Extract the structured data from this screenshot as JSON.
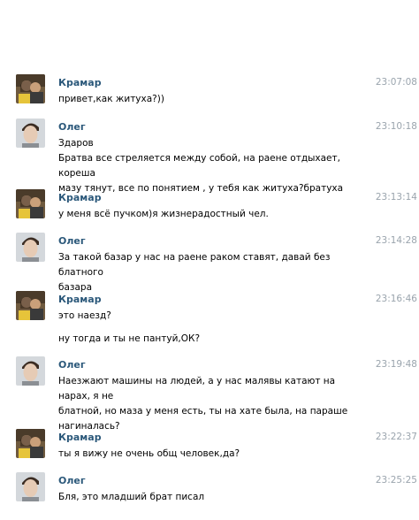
{
  "messages": [
    {
      "author": "Крамар",
      "time": "23:07:08",
      "avatar": "avatar-couple",
      "lines": [
        "привет,как житуха?))"
      ]
    },
    {
      "author": "Олег",
      "time": "23:10:18",
      "avatar": "avatar-young-man",
      "lines": [
        "Здаров",
        "Братва все стреляется между собой, на раене отдыхает, кореша",
        "мазу тянут, все по понятием , у тебя как житуха?братуха"
      ]
    },
    {
      "author": "Крамар",
      "time": "23:13:14",
      "avatar": "avatar-couple",
      "lines": [
        "у меня всё пучком)я жизнерадостный чел."
      ]
    },
    {
      "author": "Олег",
      "time": "23:14:28",
      "avatar": "avatar-young-man",
      "lines": [
        "За такой базар у нас на раене раком ставят, давай без блатного",
        "базара"
      ]
    },
    {
      "author": "Крамар",
      "time": "23:16:46",
      "avatar": "avatar-couple",
      "lines": [
        "это наезд?",
        "",
        "ну тогда и ты не пантуй,ОК?"
      ]
    },
    {
      "author": "Олег",
      "time": "23:19:48",
      "avatar": "avatar-young-man",
      "lines": [
        "Наезжают машины на людей, а у нас малявы катают на нарах, я не",
        "блатной, но маза у меня есть, ты на хате была, на параше",
        "нагиналась?"
      ]
    },
    {
      "author": "Крамар",
      "time": "23:22:37",
      "avatar": "avatar-couple",
      "lines": [
        "ты я вижу не очень общ человек,да?"
      ]
    },
    {
      "author": "Олег",
      "time": "23:25:25",
      "avatar": "avatar-young-man",
      "lines": [
        "Бля, это младший брат писал"
      ]
    }
  ]
}
